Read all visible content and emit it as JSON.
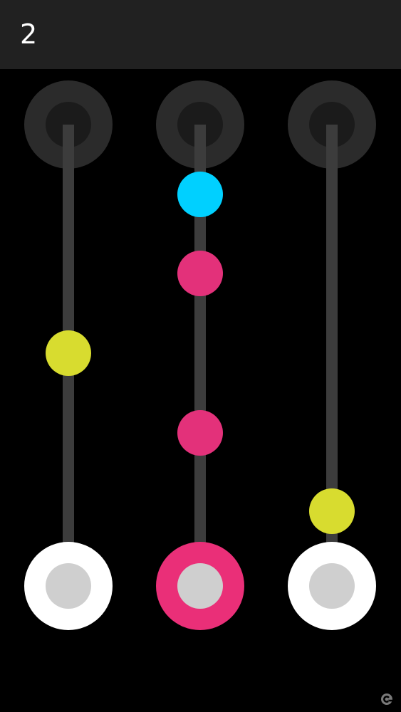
{
  "game": {
    "score": "2",
    "colors": {
      "header": "#212121",
      "track": "#3c3c3c",
      "socket_outer": "#2b2b2b",
      "socket_inner": "#1b1b1b",
      "ring_core": "#cfcfcf"
    },
    "lanes": [
      {
        "name": "left",
        "selector_color": "#ffffff",
        "balls": [
          {
            "color": "#d8dc2f"
          }
        ]
      },
      {
        "name": "middle",
        "selector_color": "#ea2f78",
        "balls": [
          {
            "color": "#00d0ff"
          },
          {
            "color": "#e3317a"
          },
          {
            "color": "#e3317a"
          }
        ]
      },
      {
        "name": "right",
        "selector_color": "#ffffff",
        "balls": [
          {
            "color": "#d8dc2f"
          }
        ]
      }
    ],
    "watermark_icon": "watermark-icon"
  }
}
